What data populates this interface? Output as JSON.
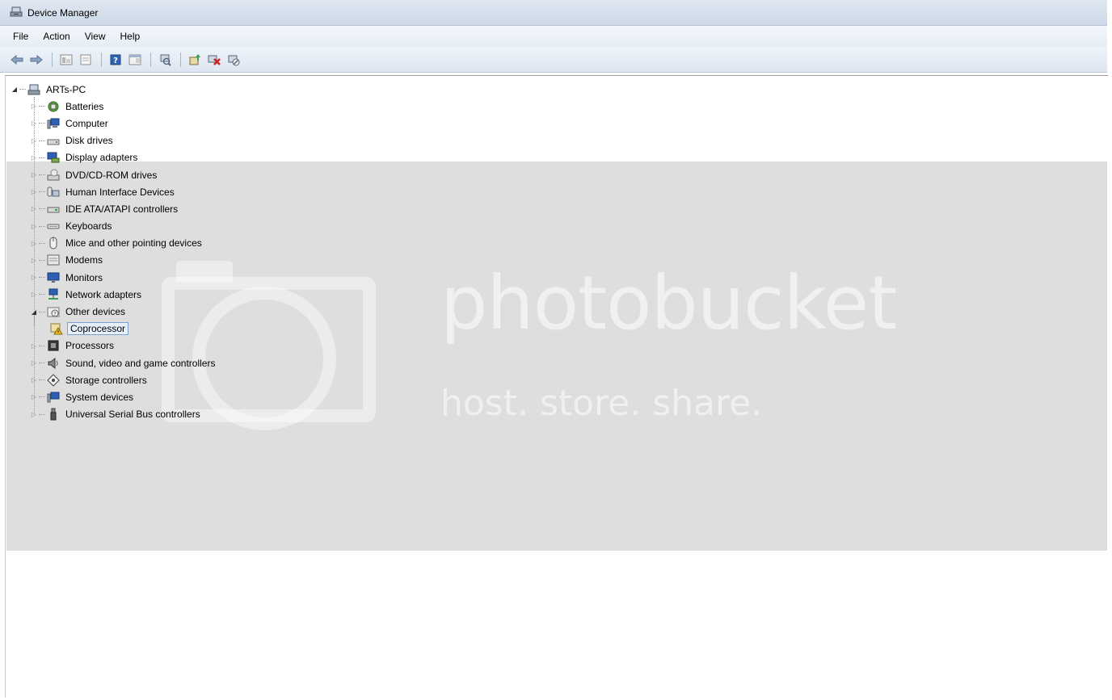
{
  "window": {
    "title": "Device Manager"
  },
  "menu": [
    "File",
    "Action",
    "View",
    "Help"
  ],
  "toolbar": {
    "buttons": [
      "back-icon",
      "forward-icon",
      "console-tree-icon",
      "properties-icon",
      "help-icon",
      "action-pane-icon",
      "scan-hardware-icon",
      "update-driver-icon",
      "uninstall-icon",
      "disable-icon"
    ]
  },
  "tree": {
    "root": "ARTs-PC",
    "categories": [
      "Batteries",
      "Computer",
      "Disk drives",
      "Display adapters",
      "DVD/CD-ROM drives",
      "Human Interface Devices",
      "IDE ATA/ATAPI controllers",
      "Keyboards",
      "Mice and other pointing devices",
      "Modems",
      "Monitors",
      "Network adapters",
      "Other devices",
      "Processors",
      "Sound, video and game controllers",
      "Storage controllers",
      "System devices",
      "Universal Serial Bus controllers"
    ],
    "other_devices_children": [
      "Coprocessor"
    ]
  },
  "watermark": {
    "brand": "photobucket",
    "tagline": "host. store. share."
  },
  "colors": {
    "titlebar": "#d5dfec",
    "band": "#dedede",
    "warning": "#f2c21b"
  }
}
